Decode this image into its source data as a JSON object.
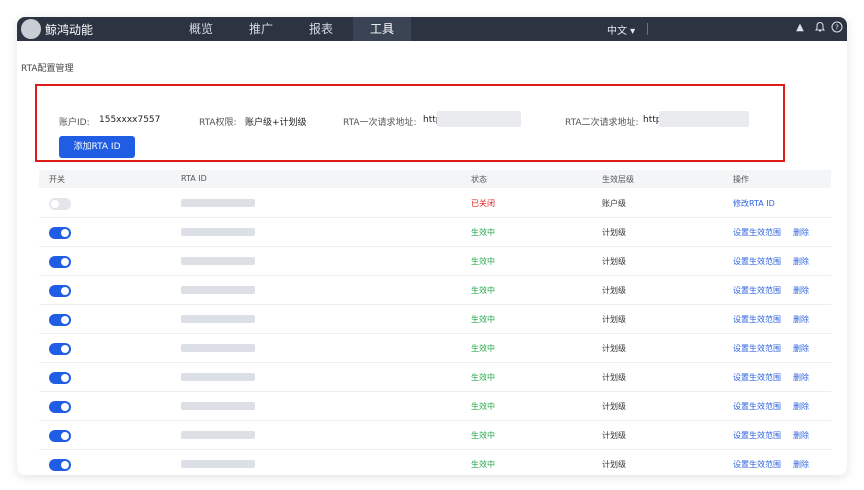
{
  "topbar": {
    "brand": "鲸鸿动能",
    "nav": [
      "概览",
      "推广",
      "报表",
      "工具"
    ],
    "active_nav": "工具",
    "language": "中文 ▾",
    "icons": [
      "caret-up-icon",
      "bell-icon",
      "help-icon"
    ]
  },
  "page": {
    "title": "RTA配置管理"
  },
  "info": {
    "account_label": "账户ID:",
    "account_value": "155xxxx7557",
    "permission_label": "RTA权限:",
    "permission_value": "账户级+计划级",
    "url1_label": "RTA一次请求地址:",
    "url1_value": "http",
    "url2_label": "RTA二次请求地址:",
    "url2_value": "http",
    "add_button": "添加RTA ID"
  },
  "table": {
    "headers": [
      "开关",
      "RTA ID",
      "状态",
      "生效层级",
      "操作"
    ],
    "rows": [
      {
        "enabled": false,
        "status": "已关闭",
        "level": "账户级",
        "actions": [
          "修改RTA ID"
        ]
      },
      {
        "enabled": true,
        "status": "生效中",
        "level": "计划级",
        "actions": [
          "设置生效范围",
          "删除"
        ]
      },
      {
        "enabled": true,
        "status": "生效中",
        "level": "计划级",
        "actions": [
          "设置生效范围",
          "删除"
        ]
      },
      {
        "enabled": true,
        "status": "生效中",
        "level": "计划级",
        "actions": [
          "设置生效范围",
          "删除"
        ]
      },
      {
        "enabled": true,
        "status": "生效中",
        "level": "计划级",
        "actions": [
          "设置生效范围",
          "删除"
        ]
      },
      {
        "enabled": true,
        "status": "生效中",
        "level": "计划级",
        "actions": [
          "设置生效范围",
          "删除"
        ]
      },
      {
        "enabled": true,
        "status": "生效中",
        "level": "计划级",
        "actions": [
          "设置生效范围",
          "删除"
        ]
      },
      {
        "enabled": true,
        "status": "生效中",
        "level": "计划级",
        "actions": [
          "设置生效范围",
          "删除"
        ]
      },
      {
        "enabled": true,
        "status": "生效中",
        "level": "计划级",
        "actions": [
          "设置生效范围",
          "删除"
        ]
      },
      {
        "enabled": true,
        "status": "生效中",
        "level": "计划级",
        "actions": [
          "设置生效范围",
          "删除"
        ]
      }
    ]
  },
  "colors": {
    "topbar_bg": "#2c3442",
    "accent_blue": "#1f5de4",
    "toggle_on": "#1f5de4",
    "toggle_off": "#e4e6ea",
    "status_on": "#22a84a",
    "status_off": "#e01b1b",
    "highlight_border": "#e01b1b"
  }
}
